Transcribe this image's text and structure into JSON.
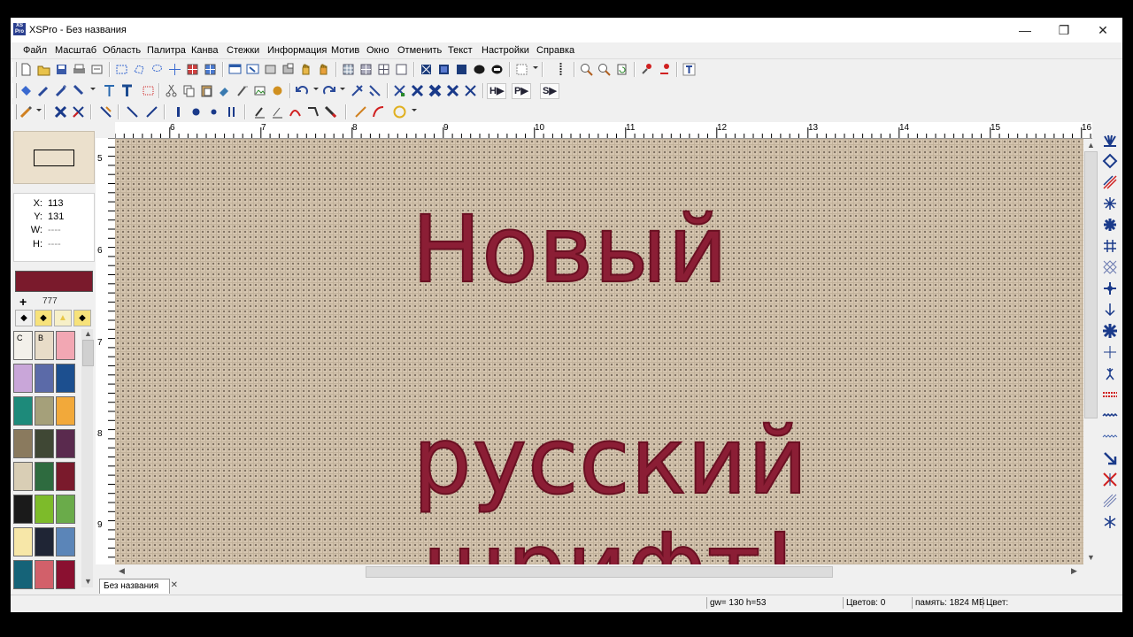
{
  "window": {
    "title": "XSPro - Без названия",
    "app_icon_text": "XSPro"
  },
  "menu": [
    "Файл",
    "Масштаб",
    "Область",
    "Палитра",
    "Канва",
    "Стежки",
    "Информация",
    "Мотив",
    "Окно",
    "Отменить",
    "Текст",
    "Настройки",
    "Справка"
  ],
  "toolbar": {
    "text_buttons": [
      "H▶",
      "P▶",
      "S▶"
    ]
  },
  "ruler": {
    "top": [
      "6",
      "7",
      "8",
      "9",
      "10",
      "11",
      "12",
      "13",
      "14",
      "15",
      "16"
    ],
    "left": [
      "5",
      "6",
      "7",
      "8",
      "9"
    ]
  },
  "coords": {
    "x_label": "X:",
    "x": "113",
    "y_label": "Y:",
    "y": "131",
    "w_label": "W:",
    "w": "----",
    "h_label": "H:",
    "h": "----"
  },
  "current_color": {
    "hex": "#7a1a2c",
    "number": "777"
  },
  "palette": [
    {
      "hex": "#f3f0ea",
      "label": "C"
    },
    {
      "hex": "#e8dcc8",
      "label": "B"
    },
    {
      "hex": "#f2a7b3",
      "label": ""
    },
    {
      "hex": "#c9a6d9",
      "label": ""
    },
    {
      "hex": "#5b6aa8",
      "label": ""
    },
    {
      "hex": "#1c4f8f",
      "label": ""
    },
    {
      "hex": "#1d8a7a",
      "label": ""
    },
    {
      "hex": "#a5a07a",
      "label": ""
    },
    {
      "hex": "#f2a93a",
      "label": ""
    },
    {
      "hex": "#8a7a5e",
      "label": ""
    },
    {
      "hex": "#3f4734",
      "label": ""
    },
    {
      "hex": "#5a2a4e",
      "label": ""
    },
    {
      "hex": "#d9ceb5",
      "label": ""
    },
    {
      "hex": "#2e6b3f",
      "label": ""
    },
    {
      "hex": "#7a1a2c",
      "label": ""
    },
    {
      "hex": "#1a1a1a",
      "label": ""
    },
    {
      "hex": "#7dbb2a",
      "label": ""
    },
    {
      "hex": "#6aab4a",
      "label": ""
    },
    {
      "hex": "#f7e7a8",
      "label": ""
    },
    {
      "hex": "#1f2535",
      "label": ""
    },
    {
      "hex": "#5b85b8",
      "label": ""
    },
    {
      "hex": "#156378",
      "label": ""
    },
    {
      "hex": "#d2606a",
      "label": ""
    },
    {
      "hex": "#8a1030",
      "label": ""
    }
  ],
  "canvas": {
    "line1": "Новый",
    "line2": "русский шрифт!",
    "stitch_color": "#8b1e35",
    "fabric_color": "#d6c6b0"
  },
  "doc_tab": "Без названия",
  "status": {
    "gw": "gw= 130  h=53",
    "colors": "Цветов: 0",
    "memory": "память: 1824 MB",
    "color": "Цвет:"
  }
}
